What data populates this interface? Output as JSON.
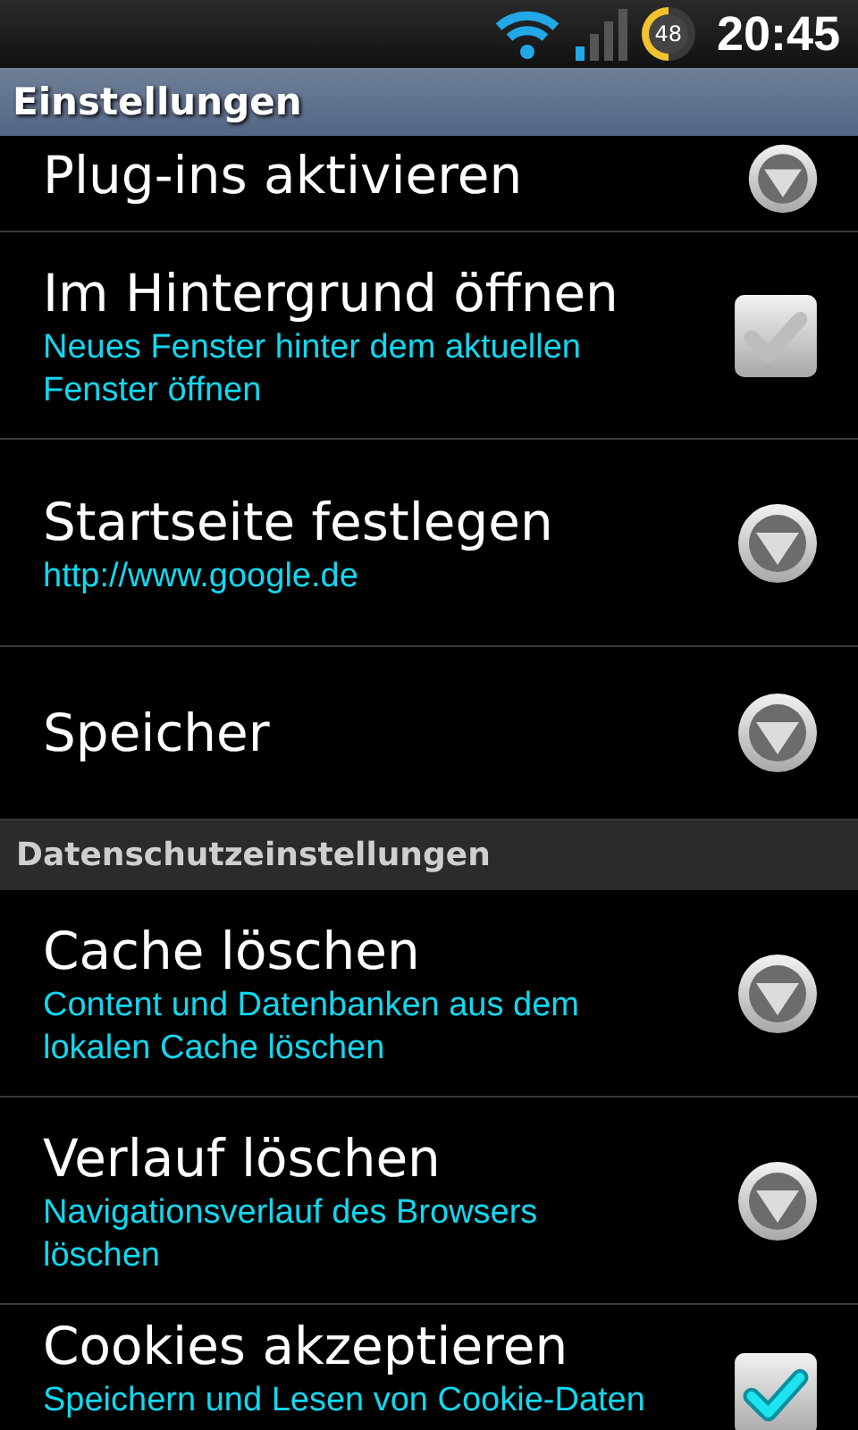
{
  "status_bar": {
    "battery": "48",
    "time": "20:45"
  },
  "title": "Einstellungen",
  "sections": [
    {
      "items": [
        {
          "kind": "dropdown",
          "title": "Plug-ins aktivieren"
        },
        {
          "kind": "checkbox",
          "title": "Im Hintergrund öffnen",
          "summary": "Neues Fenster hinter dem aktuellen Fenster öffnen",
          "checked": false
        },
        {
          "kind": "dropdown",
          "title": "Startseite festlegen",
          "summary": "http://www.google.de"
        },
        {
          "kind": "dropdown",
          "title": "Speicher"
        }
      ]
    },
    {
      "header": "Datenschutzeinstellungen",
      "items": [
        {
          "kind": "dropdown",
          "title": "Cache löschen",
          "summary": "Content und Datenbanken aus dem lokalen Cache löschen"
        },
        {
          "kind": "dropdown",
          "title": "Verlauf löschen",
          "summary": "Navigationsverlauf des Browsers löschen"
        },
        {
          "kind": "checkbox",
          "title": "Cookies akzeptieren",
          "summary": "Speichern und Lesen von Cookie-Daten",
          "checked": true
        }
      ]
    }
  ]
}
